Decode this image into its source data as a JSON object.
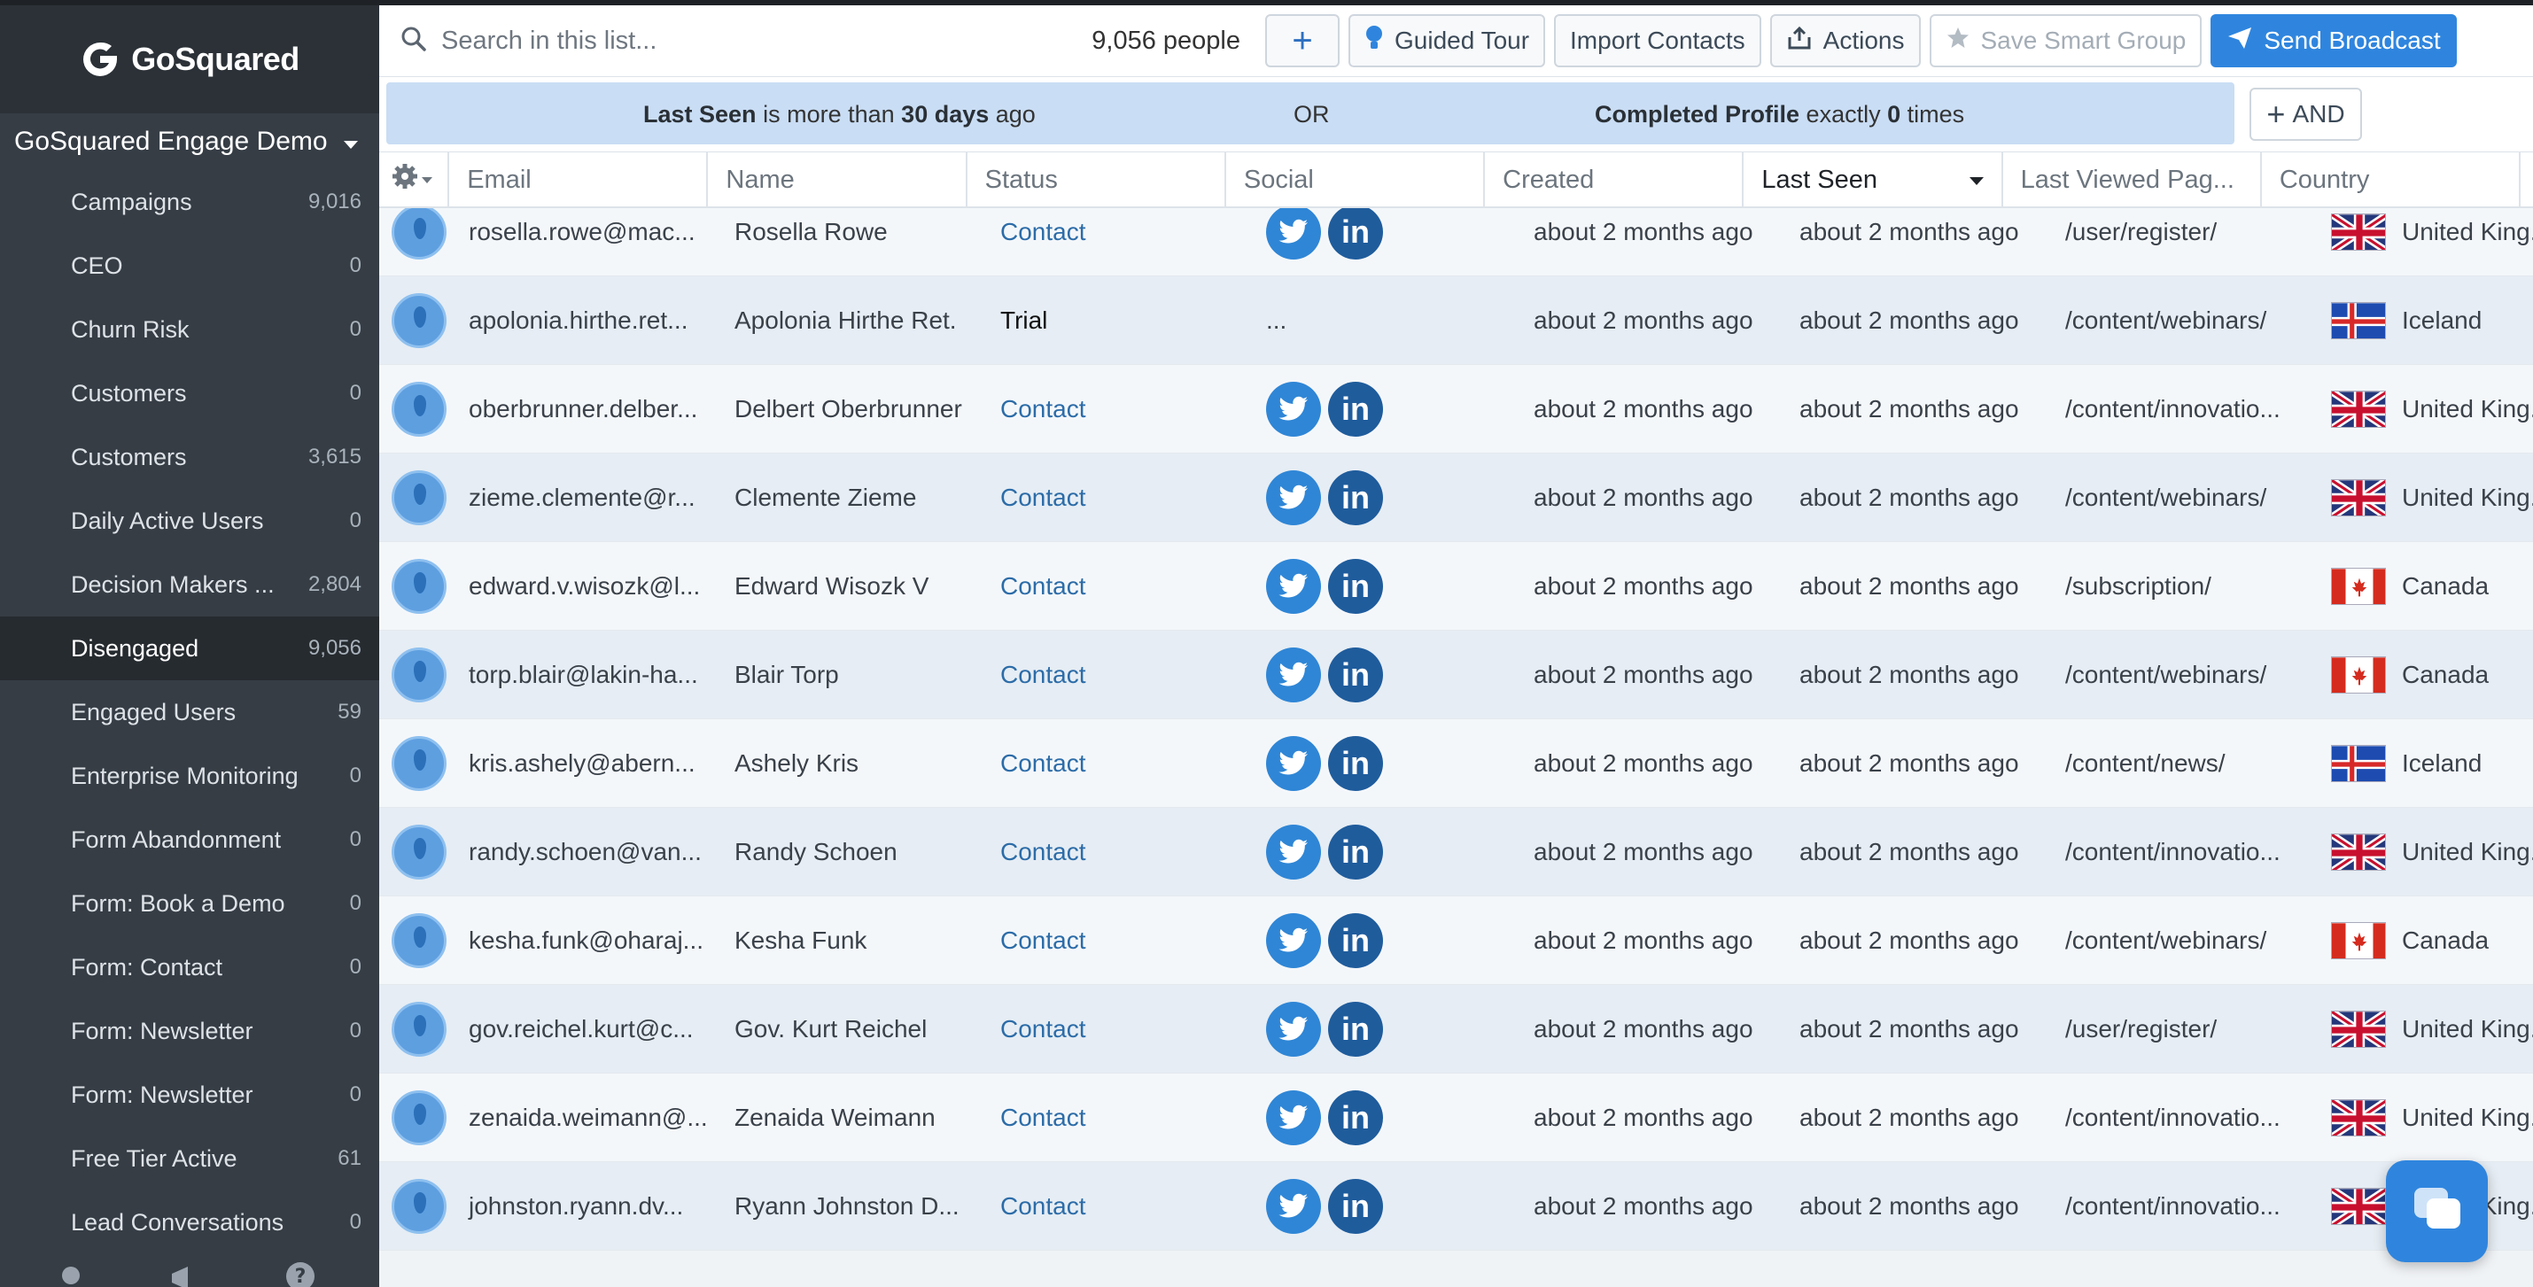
{
  "app": {
    "brand": "GoSquared",
    "project": "GoSquared Engage Demo"
  },
  "colors": {
    "sidebar": "#363d45",
    "accent": "#2f85de",
    "filter": "#c9ddf4",
    "contact_status": "#2c6ca8"
  },
  "sidebar": {
    "items": [
      {
        "label": "Campaigns",
        "count": "9,016"
      },
      {
        "label": "CEO",
        "count": "0"
      },
      {
        "label": "Churn Risk",
        "count": "0"
      },
      {
        "label": "Customers",
        "count": "0"
      },
      {
        "label": "Customers",
        "count": "3,615"
      },
      {
        "label": "Daily Active Users",
        "count": "0"
      },
      {
        "label": "Decision Makers ...",
        "count": "2,804"
      },
      {
        "label": "Disengaged",
        "count": "9,056",
        "active": true
      },
      {
        "label": "Engaged Users",
        "count": "59"
      },
      {
        "label": "Enterprise Monitoring",
        "count": "0"
      },
      {
        "label": "Form Abandonment",
        "count": "0"
      },
      {
        "label": "Form: Book a Demo",
        "count": "0"
      },
      {
        "label": "Form: Contact",
        "count": "0"
      },
      {
        "label": "Form: Newsletter",
        "count": "0"
      },
      {
        "label": "Form: Newsletter",
        "count": "0"
      },
      {
        "label": "Free Tier Active",
        "count": "61"
      },
      {
        "label": "Lead Conversations",
        "count": "0"
      }
    ],
    "bottom_icons": [
      "lightbulb-icon",
      "megaphone-icon",
      "help-icon"
    ]
  },
  "toolbar": {
    "search_placeholder": "Search in this list...",
    "people_count": "9,056 people",
    "guided_tour": "Guided Tour",
    "import_contacts": "Import Contacts",
    "actions": "Actions",
    "save_smart_group": "Save Smart Group",
    "send_broadcast": "Send Broadcast"
  },
  "filters": {
    "cond1": {
      "field": "Last Seen",
      "op": "is more than",
      "value": "30 days",
      "suffix": "ago"
    },
    "joiner": "OR",
    "cond2": {
      "field": "Completed Profile",
      "op": "exactly",
      "value": "0",
      "suffix": "times"
    },
    "and_label": "AND"
  },
  "table": {
    "columns": [
      "Email",
      "Name",
      "Status",
      "Social",
      "Created",
      "Last Seen",
      "Last Viewed Pag...",
      "Country"
    ],
    "sorted_column": "Last Seen",
    "rows": [
      {
        "email": "rosella.rowe@mac...",
        "name": "Rosella Rowe",
        "status": "Contact",
        "social": true,
        "created": "about 2 months ago",
        "last_seen": "about 2 months ago",
        "last_page": "/user/register/",
        "flag": "uk",
        "country": "United King..."
      },
      {
        "email": "apolonia.hirthe.ret...",
        "name": "Apolonia Hirthe Ret.",
        "status": "Trial",
        "social": false,
        "social_text": "...",
        "created": "about 2 months ago",
        "last_seen": "about 2 months ago",
        "last_page": "/content/webinars/",
        "flag": "iceland",
        "country": "Iceland"
      },
      {
        "email": "oberbrunner.delber...",
        "name": "Delbert Oberbrunner",
        "status": "Contact",
        "social": true,
        "created": "about 2 months ago",
        "last_seen": "about 2 months ago",
        "last_page": "/content/innovatio...",
        "flag": "uk",
        "country": "United King..."
      },
      {
        "email": "zieme.clemente@r...",
        "name": "Clemente Zieme",
        "status": "Contact",
        "social": true,
        "created": "about 2 months ago",
        "last_seen": "about 2 months ago",
        "last_page": "/content/webinars/",
        "flag": "uk",
        "country": "United King..."
      },
      {
        "email": "edward.v.wisozk@l...",
        "name": "Edward Wisozk V",
        "status": "Contact",
        "social": true,
        "created": "about 2 months ago",
        "last_seen": "about 2 months ago",
        "last_page": "/subscription/",
        "flag": "canada",
        "country": "Canada"
      },
      {
        "email": "torp.blair@lakin-ha...",
        "name": "Blair Torp",
        "status": "Contact",
        "social": true,
        "created": "about 2 months ago",
        "last_seen": "about 2 months ago",
        "last_page": "/content/webinars/",
        "flag": "canada",
        "country": "Canada"
      },
      {
        "email": "kris.ashely@abern...",
        "name": "Ashely Kris",
        "status": "Contact",
        "social": true,
        "created": "about 2 months ago",
        "last_seen": "about 2 months ago",
        "last_page": "/content/news/",
        "flag": "iceland",
        "country": "Iceland"
      },
      {
        "email": "randy.schoen@van...",
        "name": "Randy Schoen",
        "status": "Contact",
        "social": true,
        "created": "about 2 months ago",
        "last_seen": "about 2 months ago",
        "last_page": "/content/innovatio...",
        "flag": "uk",
        "country": "United King..."
      },
      {
        "email": "kesha.funk@oharaj...",
        "name": "Kesha Funk",
        "status": "Contact",
        "social": true,
        "created": "about 2 months ago",
        "last_seen": "about 2 months ago",
        "last_page": "/content/webinars/",
        "flag": "canada",
        "country": "Canada"
      },
      {
        "email": "gov.reichel.kurt@c...",
        "name": "Gov. Kurt Reichel",
        "status": "Contact",
        "social": true,
        "created": "about 2 months ago",
        "last_seen": "about 2 months ago",
        "last_page": "/user/register/",
        "flag": "uk",
        "country": "United King..."
      },
      {
        "email": "zenaida.weimann@...",
        "name": "Zenaida Weimann",
        "status": "Contact",
        "social": true,
        "created": "about 2 months ago",
        "last_seen": "about 2 months ago",
        "last_page": "/content/innovatio...",
        "flag": "uk",
        "country": "United King..."
      },
      {
        "email": "johnston.ryann.dv...",
        "name": "Ryann Johnston D...",
        "status": "Contact",
        "social": true,
        "created": "about 2 months ago",
        "last_seen": "about 2 months ago",
        "last_page": "/content/innovatio...",
        "flag": "uk",
        "country": "United King..."
      }
    ]
  }
}
